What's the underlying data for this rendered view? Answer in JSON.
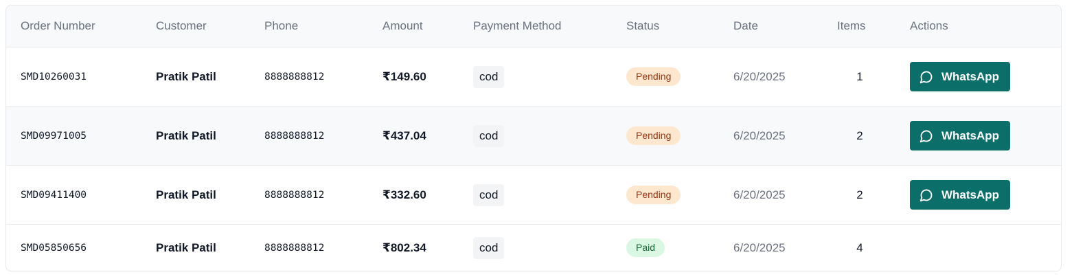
{
  "table": {
    "headers": {
      "order_number": "Order Number",
      "customer": "Customer",
      "phone": "Phone",
      "amount": "Amount",
      "payment_method": "Payment Method",
      "status": "Status",
      "date": "Date",
      "items": "Items",
      "actions": "Actions"
    },
    "rows": [
      {
        "order": "SMD10260031",
        "customer": "Pratik Patil",
        "phone": "8888888812",
        "amount": "₹149.60",
        "payment": "cod",
        "status": "Pending",
        "date": "6/20/2025",
        "items": "1",
        "action": "WhatsApp"
      },
      {
        "order": "SMD09971005",
        "customer": "Pratik Patil",
        "phone": "8888888812",
        "amount": "₹437.04",
        "payment": "cod",
        "status": "Pending",
        "date": "6/20/2025",
        "items": "2",
        "action": "WhatsApp"
      },
      {
        "order": "SMD09411400",
        "customer": "Pratik Patil",
        "phone": "8888888812",
        "amount": "₹332.60",
        "payment": "cod",
        "status": "Pending",
        "date": "6/20/2025",
        "items": "2",
        "action": "WhatsApp"
      },
      {
        "order": "SMD05850656",
        "customer": "Pratik Patil",
        "phone": "8888888812",
        "amount": "₹802.34",
        "payment": "cod",
        "status": "Paid",
        "date": "6/20/2025",
        "items": "4"
      }
    ]
  },
  "icons": {
    "whatsapp_button_icon": "chat-bubble-icon"
  },
  "colors": {
    "whatsapp_button": "#0b6e69",
    "pending_badge_bg": "#fde8cf",
    "pending_badge_text": "#9a3412",
    "paid_badge_bg": "#d9f7e3",
    "paid_badge_text": "#166534"
  }
}
